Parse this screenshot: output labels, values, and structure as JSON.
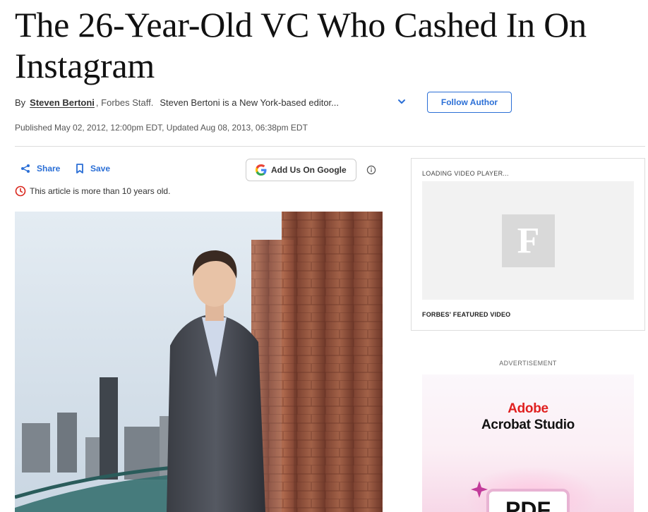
{
  "article": {
    "headline": "The 26-Year-Old VC Who Cashed In On Instagram",
    "by_label": "By",
    "author": "Steven Bertoni",
    "author_role": ", Forbes Staff.",
    "author_bio": "Steven Bertoni is a New York-based editor...",
    "follow_label": "Follow Author",
    "published": "Published May 02, 2012, 12:00pm EDT, Updated Aug 08, 2013, 06:38pm EDT",
    "age_note": "This article is more than 10 years old."
  },
  "actions": {
    "share_label": "Share",
    "save_label": "Save",
    "google_label": "Add Us On Google"
  },
  "sidebar": {
    "video_loading": "LOADING VIDEO PLAYER...",
    "video_logo": "F",
    "video_caption": "FORBES' FEATURED VIDEO",
    "ad_label": "ADVERTISEMENT",
    "ad_brand": "Adobe",
    "ad_product": "Acrobat Studio",
    "ad_badge": "PDF"
  },
  "colors": {
    "link_blue": "#2b6fd6",
    "alert_red": "#d9261c",
    "adobe_red": "#e02020"
  },
  "icons": [
    "share-icon",
    "bookmark-icon",
    "google-g-icon",
    "info-icon",
    "clock-icon",
    "chevron-down-icon"
  ]
}
